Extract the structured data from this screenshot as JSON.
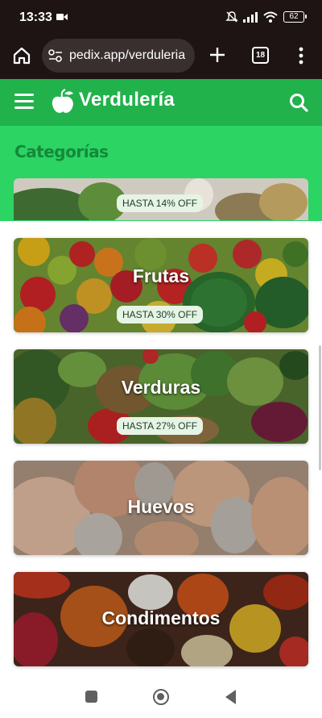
{
  "status_bar": {
    "time": "13:33",
    "battery": "62",
    "icons": [
      "video-camera-icon",
      "mute-bell-icon",
      "signal-icon",
      "wifi-icon",
      "battery-icon"
    ]
  },
  "browser": {
    "url": "pedix.app/verduleria",
    "tab_count": "18",
    "icons": [
      "home-icon",
      "site-settings-icon",
      "plus-icon",
      "tabs-icon",
      "more-menu-icon"
    ]
  },
  "header": {
    "brand": "Verdulería",
    "color": "#21b24c",
    "icons": [
      "hamburger-menu-icon",
      "fruit-logo-icon",
      "search-icon"
    ]
  },
  "categories": {
    "title": "Categorías",
    "band_color": "#2bd463",
    "items": [
      {
        "label": "",
        "badge": "HASTA 14% OFF"
      },
      {
        "label": "Frutas",
        "badge": "HASTA 30% OFF"
      },
      {
        "label": "Verduras",
        "badge": "HASTA 27% OFF"
      },
      {
        "label": "Huevos",
        "badge": ""
      },
      {
        "label": "Condimentos",
        "badge": ""
      }
    ]
  },
  "nav_bar": {
    "icons": [
      "recent-apps-icon",
      "home-circle-icon",
      "back-icon"
    ]
  }
}
